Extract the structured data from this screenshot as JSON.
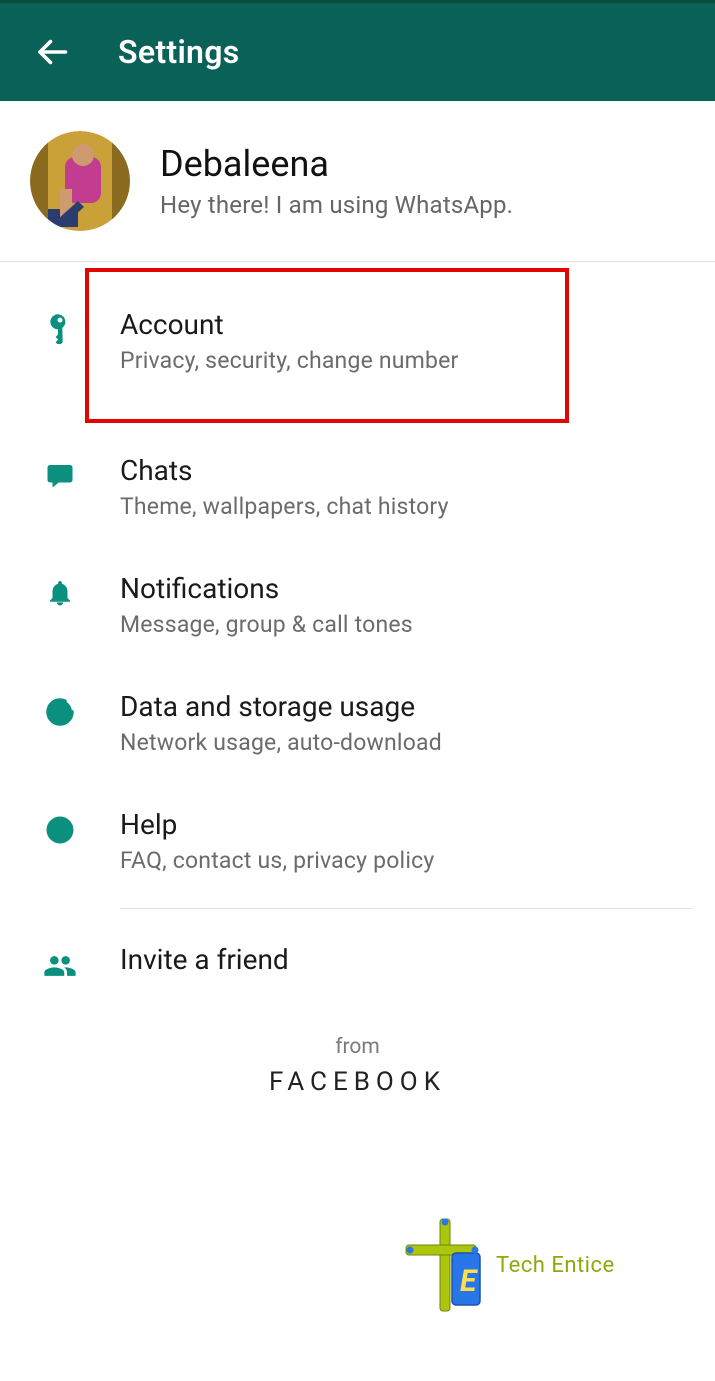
{
  "header": {
    "title": "Settings"
  },
  "profile": {
    "name": "Debaleena",
    "status": "Hey there! I am using WhatsApp."
  },
  "settings_items": [
    {
      "icon": "key-icon",
      "title": "Account",
      "subtitle": "Privacy, security, change number",
      "highlighted": true
    },
    {
      "icon": "chat-icon",
      "title": "Chats",
      "subtitle": "Theme, wallpapers, chat history"
    },
    {
      "icon": "bell-icon",
      "title": "Notifications",
      "subtitle": "Message, group & call tones"
    },
    {
      "icon": "data-icon",
      "title": "Data and storage usage",
      "subtitle": "Network usage, auto-download"
    },
    {
      "icon": "help-icon",
      "title": "Help",
      "subtitle": "FAQ, contact us, privacy policy"
    },
    {
      "icon": "people-icon",
      "title": "Invite a friend",
      "subtitle": ""
    }
  ],
  "footer": {
    "from_label": "from",
    "brand": "FACEBOOK"
  },
  "watermark": {
    "text": "Tech Entice"
  },
  "colors": {
    "toolbar_bg": "#0a6157",
    "accent": "#0b8f7f",
    "highlight_border": "#e10600"
  }
}
